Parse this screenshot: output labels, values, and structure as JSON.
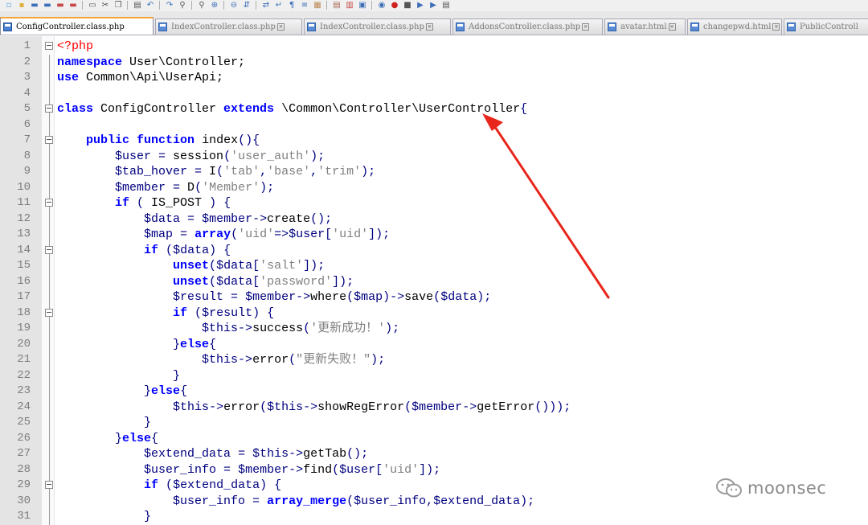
{
  "toolbar": {
    "icons": [
      "new-file-icon",
      "open-file-icon",
      "save-icon",
      "save-all-icon",
      "close-icon",
      "close-all-icon",
      "print-icon",
      "cut-icon",
      "copy-icon",
      "paste-icon",
      "undo-icon",
      "redo-icon",
      "find-icon",
      "replace-icon",
      "zoom-in-icon",
      "zoom-out-icon",
      "sync-vertical-icon",
      "sync-horizontal-icon",
      "word-wrap-icon",
      "show-all-chars-icon",
      "indent-guide-icon",
      "udl-icon",
      "doc-map-icon",
      "function-list-icon",
      "folder-workspace-icon",
      "monitor-icon",
      "record-macro-icon",
      "stop-macro-icon",
      "play-macro-icon",
      "run-macro-icon",
      "save-macro-icon"
    ]
  },
  "tabs": [
    {
      "name": "ConfigController.class.php",
      "active": true
    },
    {
      "name": "IndexController.class.php",
      "active": false
    },
    {
      "name": "IndexController.class.php",
      "active": false
    },
    {
      "name": "AddonsController.class.php",
      "active": false
    },
    {
      "name": "avatar.html",
      "active": false
    },
    {
      "name": "changepwd.html",
      "active": false
    },
    {
      "name": "PublicControll",
      "active": false
    }
  ],
  "editor": {
    "lines": [
      {
        "n": "1",
        "fold": "box-top",
        "tokens": [
          [
            "php",
            "<?php"
          ]
        ]
      },
      {
        "n": "2",
        "fold": "line",
        "tokens": [
          [
            "kw",
            "namespace"
          ],
          [
            "plain",
            " User\\Controller;"
          ]
        ]
      },
      {
        "n": "3",
        "fold": "line",
        "tokens": [
          [
            "kw",
            "use"
          ],
          [
            "plain",
            " Common\\Api\\UserApi;"
          ]
        ]
      },
      {
        "n": "4",
        "fold": "line",
        "tokens": []
      },
      {
        "n": "5",
        "fold": "box",
        "tokens": [
          [
            "kw",
            "class"
          ],
          [
            "plain",
            " ConfigController "
          ],
          [
            "kw",
            "extends"
          ],
          [
            "plain",
            " \\Common\\Controller\\UserController"
          ],
          [
            "op",
            "{"
          ]
        ]
      },
      {
        "n": "6",
        "fold": "line",
        "tokens": []
      },
      {
        "n": "7",
        "fold": "box",
        "tokens": [
          [
            "plain",
            "    "
          ],
          [
            "kw",
            "public"
          ],
          [
            "plain",
            " "
          ],
          [
            "kw",
            "function"
          ],
          [
            "plain",
            " index"
          ],
          [
            "op",
            "(){"
          ]
        ]
      },
      {
        "n": "8",
        "fold": "line",
        "tokens": [
          [
            "plain",
            "        "
          ],
          [
            "var",
            "$user"
          ],
          [
            "op",
            " = "
          ],
          [
            "fn",
            "session"
          ],
          [
            "op",
            "("
          ],
          [
            "str",
            "'user_auth'"
          ],
          [
            "op",
            ");"
          ]
        ]
      },
      {
        "n": "9",
        "fold": "line",
        "tokens": [
          [
            "plain",
            "        "
          ],
          [
            "var",
            "$tab_hover"
          ],
          [
            "op",
            " = "
          ],
          [
            "fn",
            "I"
          ],
          [
            "op",
            "("
          ],
          [
            "str",
            "'tab'"
          ],
          [
            "op",
            ","
          ],
          [
            "str",
            "'base'"
          ],
          [
            "op",
            ","
          ],
          [
            "str",
            "'trim'"
          ],
          [
            "op",
            ");"
          ]
        ]
      },
      {
        "n": "10",
        "fold": "line",
        "tokens": [
          [
            "plain",
            "        "
          ],
          [
            "var",
            "$member"
          ],
          [
            "op",
            " = "
          ],
          [
            "fn",
            "D"
          ],
          [
            "op",
            "("
          ],
          [
            "str",
            "'Member'"
          ],
          [
            "op",
            ");"
          ]
        ]
      },
      {
        "n": "11",
        "fold": "box",
        "tokens": [
          [
            "plain",
            "        "
          ],
          [
            "kw",
            "if"
          ],
          [
            "op",
            " ( "
          ],
          [
            "plain",
            "IS_POST"
          ],
          [
            "op",
            " ) {"
          ]
        ]
      },
      {
        "n": "12",
        "fold": "line",
        "tokens": [
          [
            "plain",
            "            "
          ],
          [
            "var",
            "$data"
          ],
          [
            "op",
            " = "
          ],
          [
            "var",
            "$member"
          ],
          [
            "op",
            "->"
          ],
          [
            "fn",
            "create"
          ],
          [
            "op",
            "();"
          ]
        ]
      },
      {
        "n": "13",
        "fold": "line",
        "tokens": [
          [
            "plain",
            "            "
          ],
          [
            "var",
            "$map"
          ],
          [
            "op",
            " = "
          ],
          [
            "kw",
            "array"
          ],
          [
            "op",
            "("
          ],
          [
            "str",
            "'uid'"
          ],
          [
            "op",
            "=>"
          ],
          [
            "var",
            "$user"
          ],
          [
            "op",
            "["
          ],
          [
            "str",
            "'uid'"
          ],
          [
            "op",
            "]);"
          ]
        ]
      },
      {
        "n": "14",
        "fold": "box",
        "tokens": [
          [
            "plain",
            "            "
          ],
          [
            "kw",
            "if"
          ],
          [
            "op",
            " ("
          ],
          [
            "var",
            "$data"
          ],
          [
            "op",
            ") {"
          ]
        ]
      },
      {
        "n": "15",
        "fold": "line",
        "tokens": [
          [
            "plain",
            "                "
          ],
          [
            "kw",
            "unset"
          ],
          [
            "op",
            "("
          ],
          [
            "var",
            "$data"
          ],
          [
            "op",
            "["
          ],
          [
            "str",
            "'salt'"
          ],
          [
            "op",
            "]);"
          ]
        ]
      },
      {
        "n": "16",
        "fold": "line",
        "tokens": [
          [
            "plain",
            "                "
          ],
          [
            "kw",
            "unset"
          ],
          [
            "op",
            "("
          ],
          [
            "var",
            "$data"
          ],
          [
            "op",
            "["
          ],
          [
            "str",
            "'password'"
          ],
          [
            "op",
            "]);"
          ]
        ]
      },
      {
        "n": "17",
        "fold": "line",
        "tokens": [
          [
            "plain",
            "                "
          ],
          [
            "var",
            "$result"
          ],
          [
            "op",
            " = "
          ],
          [
            "var",
            "$member"
          ],
          [
            "op",
            "->"
          ],
          [
            "fn",
            "where"
          ],
          [
            "op",
            "("
          ],
          [
            "var",
            "$map"
          ],
          [
            "op",
            ")->"
          ],
          [
            "fn",
            "save"
          ],
          [
            "op",
            "("
          ],
          [
            "var",
            "$data"
          ],
          [
            "op",
            ");"
          ]
        ]
      },
      {
        "n": "18",
        "fold": "box",
        "tokens": [
          [
            "plain",
            "                "
          ],
          [
            "kw",
            "if"
          ],
          [
            "op",
            " ("
          ],
          [
            "var",
            "$result"
          ],
          [
            "op",
            ") {"
          ]
        ]
      },
      {
        "n": "19",
        "fold": "line",
        "tokens": [
          [
            "plain",
            "                    "
          ],
          [
            "var",
            "$this"
          ],
          [
            "op",
            "->"
          ],
          [
            "fn",
            "success"
          ],
          [
            "op",
            "("
          ],
          [
            "str",
            "'更新成功！'"
          ],
          [
            "op",
            ");"
          ]
        ]
      },
      {
        "n": "20",
        "fold": "line",
        "tokens": [
          [
            "plain",
            "                "
          ],
          [
            "op",
            "}"
          ],
          [
            "kw",
            "else"
          ],
          [
            "op",
            "{"
          ]
        ]
      },
      {
        "n": "21",
        "fold": "line",
        "tokens": [
          [
            "plain",
            "                    "
          ],
          [
            "var",
            "$this"
          ],
          [
            "op",
            "->"
          ],
          [
            "fn",
            "error"
          ],
          [
            "op",
            "("
          ],
          [
            "str",
            "\"更新失败！\""
          ],
          [
            "op",
            ");"
          ]
        ]
      },
      {
        "n": "22",
        "fold": "end",
        "tokens": [
          [
            "plain",
            "                "
          ],
          [
            "op",
            "}"
          ]
        ]
      },
      {
        "n": "23",
        "fold": "line",
        "tokens": [
          [
            "plain",
            "            "
          ],
          [
            "op",
            "}"
          ],
          [
            "kw",
            "else"
          ],
          [
            "op",
            "{"
          ]
        ]
      },
      {
        "n": "24",
        "fold": "line",
        "tokens": [
          [
            "plain",
            "                "
          ],
          [
            "var",
            "$this"
          ],
          [
            "op",
            "->"
          ],
          [
            "fn",
            "error"
          ],
          [
            "op",
            "("
          ],
          [
            "var",
            "$this"
          ],
          [
            "op",
            "->"
          ],
          [
            "fn",
            "showRegError"
          ],
          [
            "op",
            "("
          ],
          [
            "var",
            "$member"
          ],
          [
            "op",
            "->"
          ],
          [
            "fn",
            "getError"
          ],
          [
            "op",
            "()));"
          ]
        ]
      },
      {
        "n": "25",
        "fold": "end",
        "tokens": [
          [
            "plain",
            "            "
          ],
          [
            "op",
            "}"
          ]
        ]
      },
      {
        "n": "26",
        "fold": "line",
        "tokens": [
          [
            "plain",
            "        "
          ],
          [
            "op",
            "}"
          ],
          [
            "kw",
            "else"
          ],
          [
            "op",
            "{"
          ]
        ]
      },
      {
        "n": "27",
        "fold": "line",
        "tokens": [
          [
            "plain",
            "            "
          ],
          [
            "var",
            "$extend_data"
          ],
          [
            "op",
            " = "
          ],
          [
            "var",
            "$this"
          ],
          [
            "op",
            "->"
          ],
          [
            "fn",
            "getTab"
          ],
          [
            "op",
            "();"
          ]
        ]
      },
      {
        "n": "28",
        "fold": "line",
        "tokens": [
          [
            "plain",
            "            "
          ],
          [
            "var",
            "$user_info"
          ],
          [
            "op",
            " = "
          ],
          [
            "var",
            "$member"
          ],
          [
            "op",
            "->"
          ],
          [
            "fn",
            "find"
          ],
          [
            "op",
            "("
          ],
          [
            "var",
            "$user"
          ],
          [
            "op",
            "["
          ],
          [
            "str",
            "'uid'"
          ],
          [
            "op",
            "]);"
          ]
        ]
      },
      {
        "n": "29",
        "fold": "box",
        "tokens": [
          [
            "plain",
            "            "
          ],
          [
            "kw",
            "if"
          ],
          [
            "op",
            " ("
          ],
          [
            "var",
            "$extend_data"
          ],
          [
            "op",
            ") {"
          ]
        ]
      },
      {
        "n": "30",
        "fold": "line",
        "tokens": [
          [
            "plain",
            "                "
          ],
          [
            "var",
            "$user_info"
          ],
          [
            "op",
            " = "
          ],
          [
            "kw",
            "array_merge"
          ],
          [
            "op",
            "("
          ],
          [
            "var",
            "$user_info"
          ],
          [
            "op",
            ","
          ],
          [
            "var",
            "$extend_data"
          ],
          [
            "op",
            ");"
          ]
        ]
      },
      {
        "n": "31",
        "fold": "end",
        "tokens": [
          [
            "plain",
            "            "
          ],
          [
            "op",
            "}"
          ]
        ]
      }
    ]
  },
  "overlay": {
    "arrow_color": "#e8261b",
    "watermark_text": "moonsec"
  }
}
